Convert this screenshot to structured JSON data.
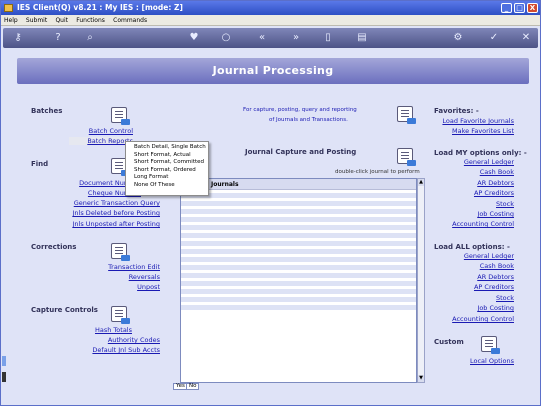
{
  "window": {
    "title": "IES Client(Q) v8.21 : My IES :       [mode: Z]",
    "buttons": [
      "_",
      "□",
      "X"
    ]
  },
  "menubar": [
    "Help",
    "Submit",
    "Quit",
    "Functions",
    "Commands"
  ],
  "toolbar_icons": [
    "key-icon",
    "help-icon",
    "search-icon",
    "heart-icon",
    "globe-icon",
    "rewind-icon",
    "fastforward-icon",
    "copy-icon",
    "document-icon",
    "gear-icon",
    "check-icon",
    "close-icon"
  ],
  "banner": {
    "title": "Journal Processing"
  },
  "batches": {
    "heading": "Batches",
    "links": [
      "Batch Control",
      "Batch Reports"
    ]
  },
  "find": {
    "heading": "Find",
    "links": [
      "Document Number",
      "Cheque Number",
      "Generic Transaction Query",
      "Jnls Deleted before Posting",
      "Jnls Unposted after Posting"
    ]
  },
  "corrections": {
    "heading": "Corrections",
    "links": [
      "Transaction Edit",
      "Reversals",
      "Unpost"
    ]
  },
  "capture_controls": {
    "heading": "Capture Controls",
    "links": [
      "Hash Totals",
      "Authority Codes",
      "Default Jnl Sub Accts"
    ]
  },
  "center": {
    "note_line1": "For capture, posting, query and reporting",
    "note_line2": "of Journals and Transactions.",
    "capture_title": "Journal Capture and Posting",
    "hint": "double-click journal to perform",
    "list_header": "Journals",
    "yes_label": "Yes",
    "no_label": "No"
  },
  "context_menu": {
    "items": [
      "Batch Detail, Single Batch",
      "Short Format, Actual",
      "Short Format, Committed",
      "Short Format, Ordered",
      "Long Format",
      "None Of These"
    ]
  },
  "favorites": {
    "heading": "Favorites: -",
    "links": [
      "Load Favorite Journals",
      "Make Favorites List"
    ]
  },
  "load_my": {
    "heading": "Load MY options only: -",
    "links": [
      "General Ledger",
      "Cash Book",
      "AR Debtors",
      "AP Creditors",
      "Stock",
      "Job Costing",
      "Accounting Control"
    ]
  },
  "load_all": {
    "heading": "Load ALL options: -",
    "links": [
      "General Ledger",
      "Cash Book",
      "AR Debtors",
      "AP Creditors",
      "Stock",
      "Job Costing",
      "Accounting Control"
    ]
  },
  "custom": {
    "heading": "Custom",
    "links": [
      "Local Options"
    ]
  }
}
